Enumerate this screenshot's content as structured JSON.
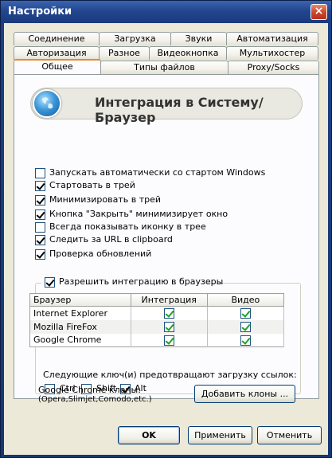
{
  "window": {
    "title": "Настройки",
    "close_glyph": "×"
  },
  "tabs": {
    "row1": [
      "Соединение",
      "Загрузка",
      "Звуки",
      "Автоматизация"
    ],
    "row2": [
      "Авторизация",
      "Разное",
      "Видеокнопка",
      "Мультихостер"
    ],
    "row3": [
      "Общее",
      "Типы файлов",
      "Proxy/Socks"
    ],
    "active": "Общее"
  },
  "header": {
    "title": "Интеграция в Систему/Браузер",
    "icon": "globe-icon"
  },
  "options": [
    {
      "label": "Запускать автоматически со стартом Windows",
      "checked": false
    },
    {
      "label": "Стартовать в трей",
      "checked": true
    },
    {
      "label": "Минимизировать в трей",
      "checked": true
    },
    {
      "label": "Кнопка \"Закрыть\" минимизирует окно",
      "checked": true
    },
    {
      "label": "Всегда показывать иконку в трее",
      "checked": false
    },
    {
      "label": "Следить за URL в clipboard",
      "checked": true
    },
    {
      "label": "Проверка обновлений",
      "checked": true
    }
  ],
  "integration": {
    "label": "Разрешить интеграцию в браузеры",
    "checked": true,
    "columns": [
      "Браузер",
      "Интеграция",
      "Видео"
    ],
    "rows": [
      {
        "name": "Internet Explorer",
        "integration": true,
        "video": true
      },
      {
        "name": "Mozilla FireFox",
        "integration": true,
        "video": true
      },
      {
        "name": "Google Chrome",
        "integration": true,
        "video": true
      }
    ],
    "keys_label": "Следующие ключ(и) предотвращают загрузку ссылок:",
    "keys": [
      {
        "label": "Ctrl",
        "checked": false
      },
      {
        "label": "Shift",
        "checked": false
      },
      {
        "label": "Alt",
        "checked": true
      }
    ]
  },
  "clones": {
    "label_line1": "Google Chrome клоны:",
    "label_line2": "(Opera,Slimjet,Comodo,etc.)",
    "button": "Добавить клоны ..."
  },
  "buttons": {
    "ok": "OK",
    "apply": "Применить",
    "cancel": "Отменить"
  }
}
